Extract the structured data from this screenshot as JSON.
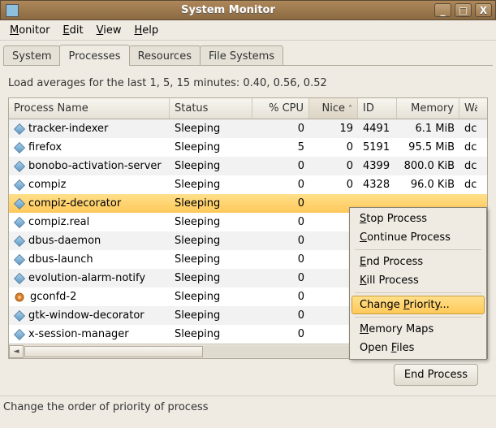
{
  "window": {
    "title": "System Monitor",
    "min_icon": "_",
    "max_icon": "□",
    "close_icon": "X"
  },
  "menubar": {
    "monitor": {
      "ul": "M",
      "rest": "onitor"
    },
    "edit": {
      "ul": "E",
      "rest": "dit"
    },
    "view": {
      "ul": "V",
      "rest": "iew"
    },
    "help": {
      "ul": "H",
      "rest": "elp"
    }
  },
  "tabs": {
    "system": "System",
    "processes": "Processes",
    "resources": "Resources",
    "filesystems": "File Systems"
  },
  "load_text": "Load averages for the last 1, 5, 15 minutes: 0.40, 0.56, 0.52",
  "columns": {
    "name": "Process Name",
    "status": "Status",
    "cpu": "% CPU",
    "nice": "Nice",
    "id": "ID",
    "memory": "Memory",
    "wait": "Wa"
  },
  "sort_arrow": "˄",
  "rows": [
    {
      "icon": "diamond",
      "name": "tracker-indexer",
      "status": "Sleeping",
      "cpu": "0",
      "nice": "19",
      "id": "4491",
      "mem": "6.1 MiB",
      "wait": "dc"
    },
    {
      "icon": "diamond",
      "name": "firefox",
      "status": "Sleeping",
      "cpu": "5",
      "nice": "0",
      "id": "5191",
      "mem": "95.5 MiB",
      "wait": "dc"
    },
    {
      "icon": "diamond",
      "name": "bonobo-activation-server",
      "status": "Sleeping",
      "cpu": "0",
      "nice": "0",
      "id": "4399",
      "mem": "800.0 KiB",
      "wait": "dc"
    },
    {
      "icon": "diamond",
      "name": "compiz",
      "status": "Sleeping",
      "cpu": "0",
      "nice": "0",
      "id": "4328",
      "mem": "96.0 KiB",
      "wait": "dc"
    },
    {
      "icon": "diamond",
      "name": "compiz-decorator",
      "status": "Sleeping",
      "cpu": "0",
      "nice": "",
      "id": "",
      "mem": "",
      "wait": ""
    },
    {
      "icon": "diamond",
      "name": "compiz.real",
      "status": "Sleeping",
      "cpu": "0",
      "nice": "",
      "id": "",
      "mem": "",
      "wait": ""
    },
    {
      "icon": "diamond",
      "name": "dbus-daemon",
      "status": "Sleeping",
      "cpu": "0",
      "nice": "",
      "id": "",
      "mem": "",
      "wait": ""
    },
    {
      "icon": "diamond",
      "name": "dbus-launch",
      "status": "Sleeping",
      "cpu": "0",
      "nice": "",
      "id": "",
      "mem": "",
      "wait": ""
    },
    {
      "icon": "diamond",
      "name": "evolution-alarm-notify",
      "status": "Sleeping",
      "cpu": "0",
      "nice": "",
      "id": "",
      "mem": "",
      "wait": ""
    },
    {
      "icon": "gear",
      "name": "gconfd-2",
      "status": "Sleeping",
      "cpu": "0",
      "nice": "",
      "id": "",
      "mem": "",
      "wait": ""
    },
    {
      "icon": "diamond",
      "name": "gtk-window-decorator",
      "status": "Sleeping",
      "cpu": "0",
      "nice": "",
      "id": "",
      "mem": "",
      "wait": ""
    },
    {
      "icon": "diamond",
      "name": "x-session-manager",
      "status": "Sleeping",
      "cpu": "0",
      "nice": "",
      "id": "",
      "mem": "",
      "wait": ""
    }
  ],
  "selected_row_index": 4,
  "context_menu": {
    "stop": {
      "ul": "S",
      "rest": "top Process"
    },
    "continue": {
      "ul": "C",
      "rest": "ontinue Process"
    },
    "end": {
      "ul": "E",
      "rest": "nd Process"
    },
    "kill": {
      "ul": "K",
      "rest": "ill Process"
    },
    "priority": {
      "prefix": "Change ",
      "ul": "P",
      "rest": "riority..."
    },
    "memory": {
      "ul": "M",
      "rest": "emory Maps"
    },
    "files": {
      "prefix": "Open ",
      "ul": "F",
      "rest": "iles"
    }
  },
  "end_button": "End Process",
  "status_text": "Change the order of priority of process"
}
